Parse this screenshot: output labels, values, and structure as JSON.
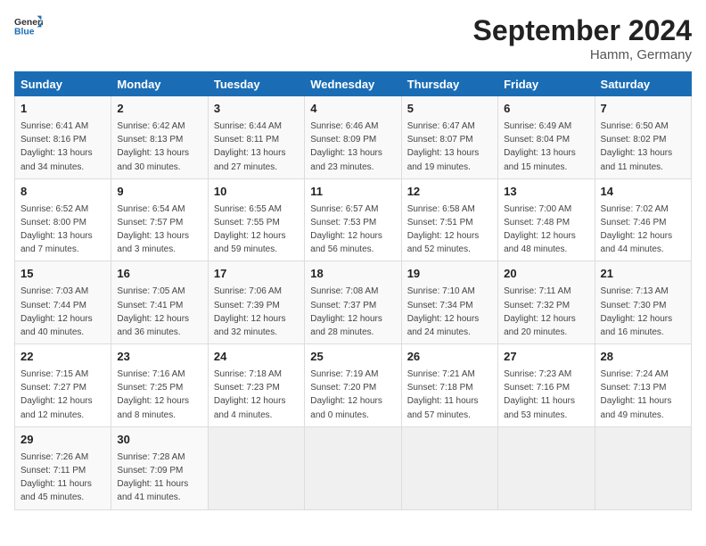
{
  "header": {
    "logo_text_general": "General",
    "logo_text_blue": "Blue",
    "month_title": "September 2024",
    "location": "Hamm, Germany"
  },
  "calendar": {
    "days_of_week": [
      "Sunday",
      "Monday",
      "Tuesday",
      "Wednesday",
      "Thursday",
      "Friday",
      "Saturday"
    ],
    "weeks": [
      [
        null,
        {
          "day": "2",
          "sunrise": "Sunrise: 6:42 AM",
          "sunset": "Sunset: 8:13 PM",
          "daylight": "Daylight: 13 hours and 30 minutes."
        },
        {
          "day": "3",
          "sunrise": "Sunrise: 6:44 AM",
          "sunset": "Sunset: 8:11 PM",
          "daylight": "Daylight: 13 hours and 27 minutes."
        },
        {
          "day": "4",
          "sunrise": "Sunrise: 6:46 AM",
          "sunset": "Sunset: 8:09 PM",
          "daylight": "Daylight: 13 hours and 23 minutes."
        },
        {
          "day": "5",
          "sunrise": "Sunrise: 6:47 AM",
          "sunset": "Sunset: 8:07 PM",
          "daylight": "Daylight: 13 hours and 19 minutes."
        },
        {
          "day": "6",
          "sunrise": "Sunrise: 6:49 AM",
          "sunset": "Sunset: 8:04 PM",
          "daylight": "Daylight: 13 hours and 15 minutes."
        },
        {
          "day": "7",
          "sunrise": "Sunrise: 6:50 AM",
          "sunset": "Sunset: 8:02 PM",
          "daylight": "Daylight: 13 hours and 11 minutes."
        }
      ],
      [
        {
          "day": "1",
          "sunrise": "Sunrise: 6:41 AM",
          "sunset": "Sunset: 8:16 PM",
          "daylight": "Daylight: 13 hours and 34 minutes."
        },
        {
          "day": "9",
          "sunrise": "Sunrise: 6:54 AM",
          "sunset": "Sunset: 7:57 PM",
          "daylight": "Daylight: 13 hours and 3 minutes."
        },
        {
          "day": "10",
          "sunrise": "Sunrise: 6:55 AM",
          "sunset": "Sunset: 7:55 PM",
          "daylight": "Daylight: 12 hours and 59 minutes."
        },
        {
          "day": "11",
          "sunrise": "Sunrise: 6:57 AM",
          "sunset": "Sunset: 7:53 PM",
          "daylight": "Daylight: 12 hours and 56 minutes."
        },
        {
          "day": "12",
          "sunrise": "Sunrise: 6:58 AM",
          "sunset": "Sunset: 7:51 PM",
          "daylight": "Daylight: 12 hours and 52 minutes."
        },
        {
          "day": "13",
          "sunrise": "Sunrise: 7:00 AM",
          "sunset": "Sunset: 7:48 PM",
          "daylight": "Daylight: 12 hours and 48 minutes."
        },
        {
          "day": "14",
          "sunrise": "Sunrise: 7:02 AM",
          "sunset": "Sunset: 7:46 PM",
          "daylight": "Daylight: 12 hours and 44 minutes."
        }
      ],
      [
        {
          "day": "8",
          "sunrise": "Sunrise: 6:52 AM",
          "sunset": "Sunset: 8:00 PM",
          "daylight": "Daylight: 13 hours and 7 minutes."
        },
        {
          "day": "16",
          "sunrise": "Sunrise: 7:05 AM",
          "sunset": "Sunset: 7:41 PM",
          "daylight": "Daylight: 12 hours and 36 minutes."
        },
        {
          "day": "17",
          "sunrise": "Sunrise: 7:06 AM",
          "sunset": "Sunset: 7:39 PM",
          "daylight": "Daylight: 12 hours and 32 minutes."
        },
        {
          "day": "18",
          "sunrise": "Sunrise: 7:08 AM",
          "sunset": "Sunset: 7:37 PM",
          "daylight": "Daylight: 12 hours and 28 minutes."
        },
        {
          "day": "19",
          "sunrise": "Sunrise: 7:10 AM",
          "sunset": "Sunset: 7:34 PM",
          "daylight": "Daylight: 12 hours and 24 minutes."
        },
        {
          "day": "20",
          "sunrise": "Sunrise: 7:11 AM",
          "sunset": "Sunset: 7:32 PM",
          "daylight": "Daylight: 12 hours and 20 minutes."
        },
        {
          "day": "21",
          "sunrise": "Sunrise: 7:13 AM",
          "sunset": "Sunset: 7:30 PM",
          "daylight": "Daylight: 12 hours and 16 minutes."
        }
      ],
      [
        {
          "day": "15",
          "sunrise": "Sunrise: 7:03 AM",
          "sunset": "Sunset: 7:44 PM",
          "daylight": "Daylight: 12 hours and 40 minutes."
        },
        {
          "day": "23",
          "sunrise": "Sunrise: 7:16 AM",
          "sunset": "Sunset: 7:25 PM",
          "daylight": "Daylight: 12 hours and 8 minutes."
        },
        {
          "day": "24",
          "sunrise": "Sunrise: 7:18 AM",
          "sunset": "Sunset: 7:23 PM",
          "daylight": "Daylight: 12 hours and 4 minutes."
        },
        {
          "day": "25",
          "sunrise": "Sunrise: 7:19 AM",
          "sunset": "Sunset: 7:20 PM",
          "daylight": "Daylight: 12 hours and 0 minutes."
        },
        {
          "day": "26",
          "sunrise": "Sunrise: 7:21 AM",
          "sunset": "Sunset: 7:18 PM",
          "daylight": "Daylight: 11 hours and 57 minutes."
        },
        {
          "day": "27",
          "sunrise": "Sunrise: 7:23 AM",
          "sunset": "Sunset: 7:16 PM",
          "daylight": "Daylight: 11 hours and 53 minutes."
        },
        {
          "day": "28",
          "sunrise": "Sunrise: 7:24 AM",
          "sunset": "Sunset: 7:13 PM",
          "daylight": "Daylight: 11 hours and 49 minutes."
        }
      ],
      [
        {
          "day": "22",
          "sunrise": "Sunrise: 7:15 AM",
          "sunset": "Sunset: 7:27 PM",
          "daylight": "Daylight: 12 hours and 12 minutes."
        },
        {
          "day": "30",
          "sunrise": "Sunrise: 7:28 AM",
          "sunset": "Sunset: 7:09 PM",
          "daylight": "Daylight: 11 hours and 41 minutes."
        },
        null,
        null,
        null,
        null,
        null
      ],
      [
        {
          "day": "29",
          "sunrise": "Sunrise: 7:26 AM",
          "sunset": "Sunset: 7:11 PM",
          "daylight": "Daylight: 11 hours and 45 minutes."
        },
        null,
        null,
        null,
        null,
        null,
        null
      ]
    ]
  }
}
